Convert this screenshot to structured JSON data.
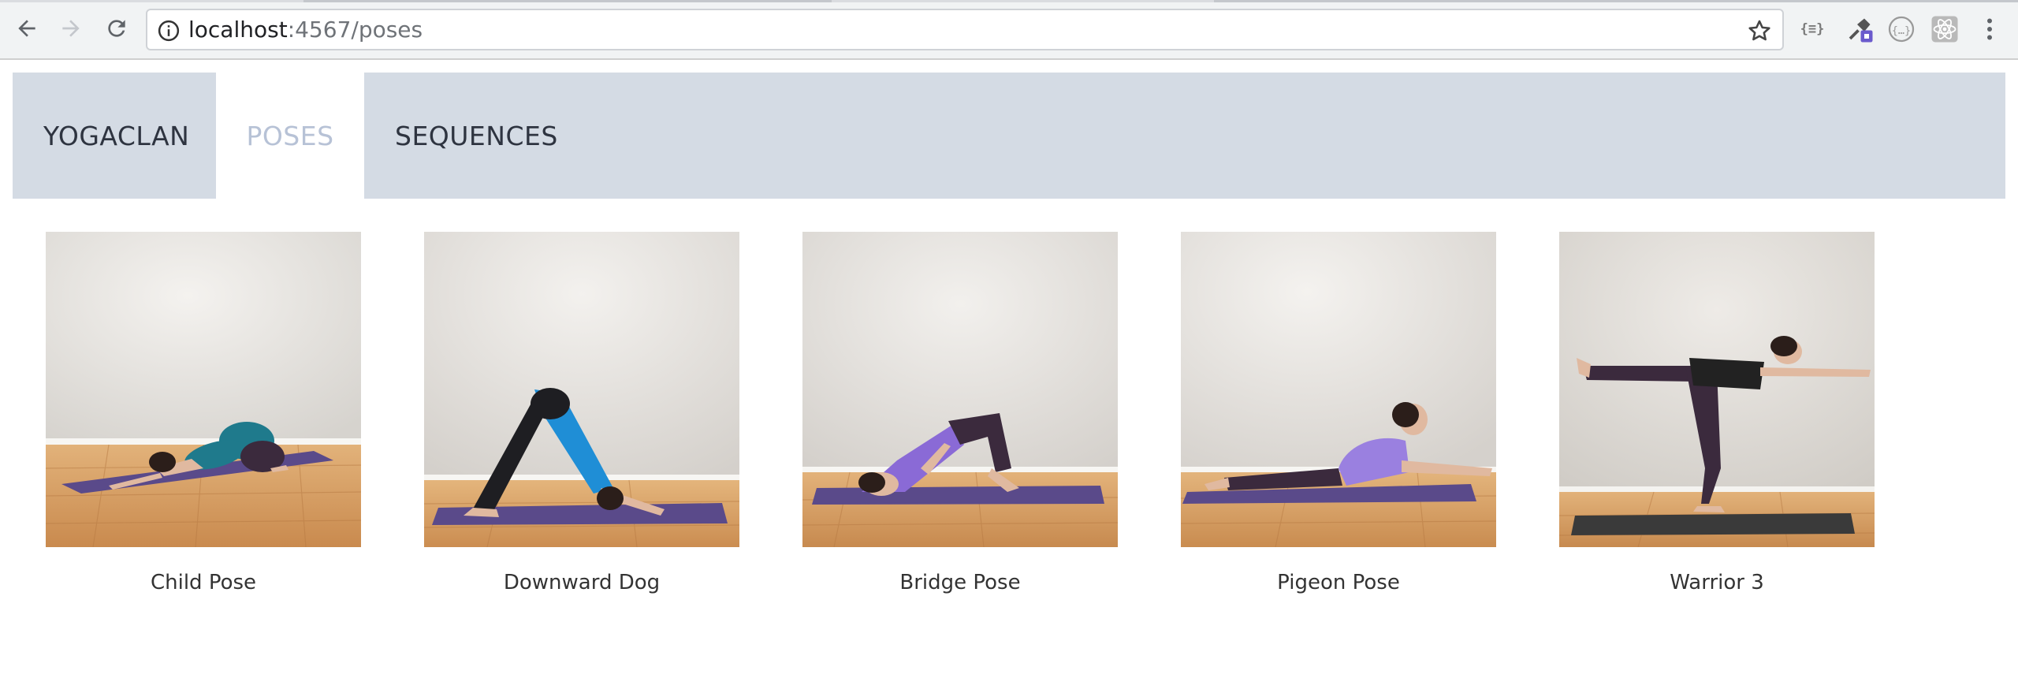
{
  "browser": {
    "url_host": "localhost",
    "url_rest": ":4567/poses",
    "extensions": [
      {
        "name": "json-formatter-icon",
        "label": "{≡}"
      },
      {
        "name": "eyedropper-extension-icon",
        "label": ""
      },
      {
        "name": "code-extension-icon",
        "label": "{…}"
      },
      {
        "name": "react-devtools-icon",
        "label": ""
      }
    ]
  },
  "nav": {
    "brand": "YOGACLAN",
    "items": [
      {
        "label": "POSES",
        "active": true
      },
      {
        "label": "SEQUENCES",
        "active": false
      }
    ]
  },
  "poses": [
    {
      "name": "Child Pose",
      "mat_color": "#5a4a8a",
      "top_color": "#1f7a8c"
    },
    {
      "name": "Downward Dog",
      "mat_color": "#5a4a8a",
      "top_color": "#1f8ed6"
    },
    {
      "name": "Bridge Pose",
      "mat_color": "#5a4a8a",
      "top_color": "#8a6ad6"
    },
    {
      "name": "Pigeon Pose",
      "mat_color": "#5a4a8a",
      "top_color": "#9a80e0"
    },
    {
      "name": "Warrior 3",
      "mat_color": "#3a3a3a",
      "top_color": "#222222"
    }
  ],
  "colors": {
    "nav_bg": "#d4dbe4",
    "active_text": "#b7c2d6",
    "wall": "#e6e4e0",
    "floor": "#d9a56b"
  }
}
